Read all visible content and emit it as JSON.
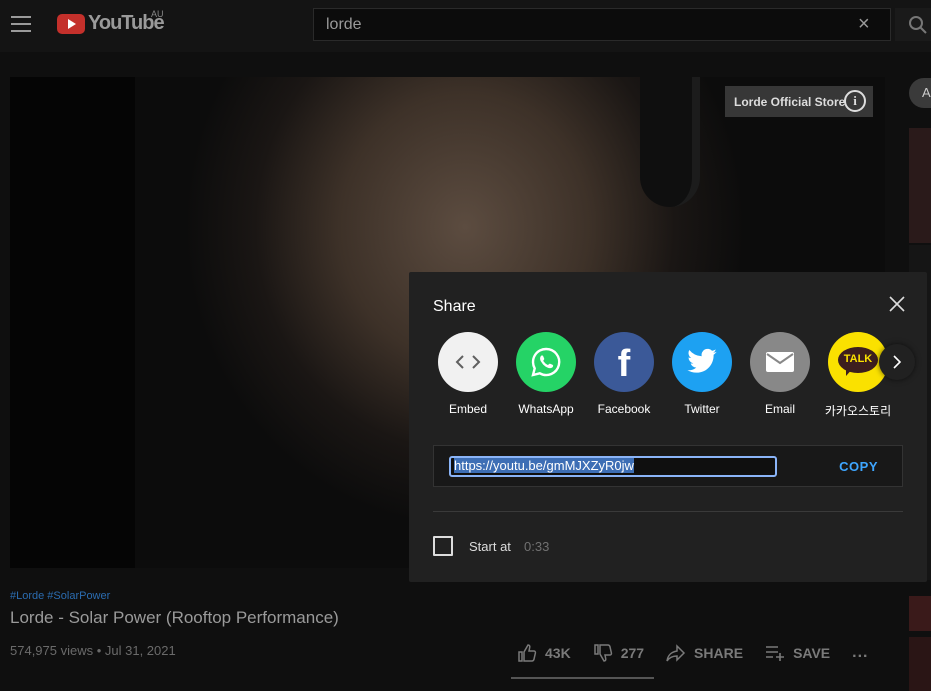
{
  "topbar": {
    "logo_text": "YouTube",
    "region": "AU",
    "search_value": "lorde",
    "clear_glyph": "×"
  },
  "video": {
    "store_badge": "Lorde Official Store",
    "info_glyph": "i"
  },
  "sidebar": {
    "chip_label": "A"
  },
  "meta": {
    "hashtags": "#Lorde #SolarPower",
    "title": "Lorde - Solar Power (Rooftop Performance)",
    "views": "574,975 views • Jul 31, 2021",
    "likes": "43K",
    "dislikes": "277",
    "share_label": "SHARE",
    "save_label": "SAVE",
    "more_glyph": "..."
  },
  "share": {
    "title": "Share",
    "targets": [
      {
        "label": "Embed",
        "icon": "embed-icon",
        "color": "#f1f1f1"
      },
      {
        "label": "WhatsApp",
        "icon": "whatsapp-icon",
        "color": "#25d366"
      },
      {
        "label": "Facebook",
        "icon": "facebook-icon",
        "color": "#3b5998"
      },
      {
        "label": "Twitter",
        "icon": "twitter-icon",
        "color": "#1da1f2"
      },
      {
        "label": "Email",
        "icon": "email-icon",
        "color": "#888888"
      },
      {
        "label": "카카오스토리",
        "icon": "kakaotalk-icon",
        "color": "#fae100"
      }
    ],
    "kakao_text": "TALK",
    "facebook_glyph": "f",
    "link": "https://youtu.be/gmMJXZyR0jw",
    "copy_label": "COPY",
    "start_at_label": "Start at",
    "start_at_time": "0:33"
  }
}
